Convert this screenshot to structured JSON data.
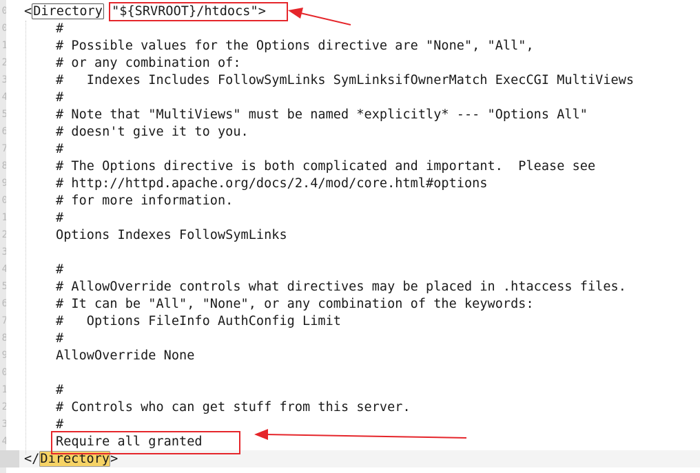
{
  "editor": {
    "line_numbers": [
      "0",
      "0",
      "1",
      "2",
      "3",
      "4",
      "5",
      "6",
      "7",
      "8",
      "9",
      "0",
      "1",
      "2",
      "3",
      "4",
      "5",
      "6",
      "7",
      "8",
      "9",
      "0",
      "1",
      "2",
      "3",
      "4",
      "5"
    ],
    "open_tag": {
      "lt": "<",
      "name": "Directory",
      "value": "\"${SRVROOT}/htdocs\"",
      "gt": ">"
    },
    "lines": [
      "#",
      "# Possible values for the Options directive are \"None\", \"All\",",
      "# or any combination of:",
      "#   Indexes Includes FollowSymLinks SymLinksifOwnerMatch ExecCGI MultiViews",
      "#",
      "# Note that \"MultiViews\" must be named *explicitly* --- \"Options All\"",
      "# doesn't give it to you.",
      "#",
      "# The Options directive is both complicated and important.  Please see",
      "# http://httpd.apache.org/docs/2.4/mod/core.html#options",
      "# for more information.",
      "#",
      "Options Indexes FollowSymLinks",
      "",
      "#",
      "# AllowOverride controls what directives may be placed in .htaccess files.",
      "# It can be \"All\", \"None\", or any combination of the keywords:",
      "#   Options FileInfo AuthConfig Limit",
      "#",
      "AllowOverride None",
      "",
      "#",
      "# Controls who can get stuff from this server.",
      "#",
      "Require all granted"
    ],
    "close_tag": {
      "lt": "</",
      "name": "Directory",
      "gt": ">"
    }
  },
  "annotations": {
    "color": "#e5252a"
  }
}
